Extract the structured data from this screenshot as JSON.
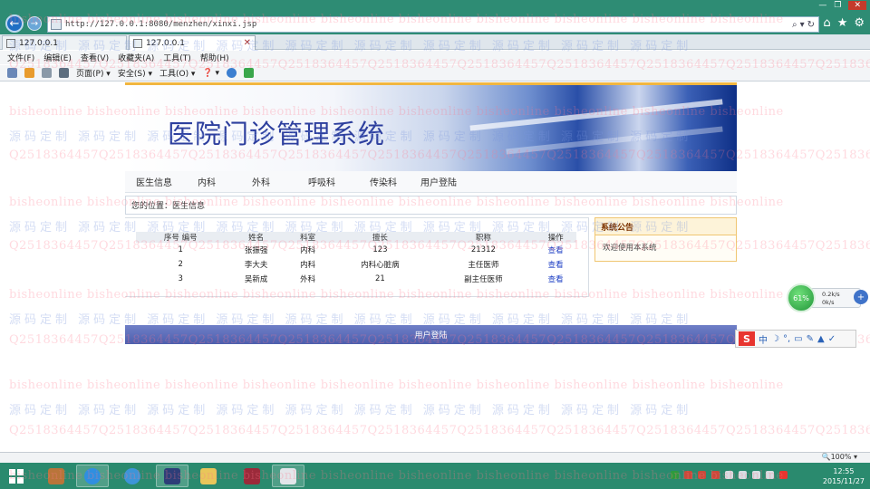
{
  "browser": {
    "url": "http://127.0.0.1:8080/menzhen/xinxi.jsp",
    "tabs": [
      {
        "label": "127.0.0.1"
      },
      {
        "label": "127.0.0.1",
        "active": true
      }
    ],
    "menu": [
      "文件(F)",
      "编辑(E)",
      "查看(V)",
      "收藏夹(A)",
      "工具(T)",
      "帮助(H)"
    ],
    "commands": {
      "page": "页面(P) ▾",
      "safety": "安全(S) ▾",
      "tools": "工具(O) ▾",
      "help": "❓ ▾"
    },
    "zoom": "🔍100%  ▾"
  },
  "site": {
    "title": "医院门诊管理系统",
    "nav": [
      "医生信息",
      "内科",
      "外科",
      "呼吸科",
      "传染科",
      "用户登陆"
    ],
    "breadcrumb": "您的位置：医生信息",
    "table": {
      "headers": [
        "编号",
        "姓名",
        "科室",
        "擅长",
        "职称",
        "操作"
      ],
      "leading_header": "序号",
      "rows": [
        {
          "id": "1",
          "name": "张振强",
          "dept": "内科",
          "specialty": "123",
          "title": "21312",
          "action": "查看"
        },
        {
          "id": "2",
          "name": "李大夫",
          "dept": "内科",
          "specialty": "内科心脏病",
          "title": "主任医师",
          "action": "查看"
        },
        {
          "id": "3",
          "name": "吴新成",
          "dept": "外科",
          "specialty": "21",
          "title": "副主任医师",
          "action": "查看"
        }
      ]
    },
    "notice": {
      "title": "系统公告",
      "body": "欢迎使用本系统"
    },
    "footer": "用户登陆"
  },
  "watermark": {
    "latin": "bisheonline",
    "cn": "源码定制",
    "qq": "Q2518364457"
  },
  "widgets": {
    "speed": {
      "percent": "61%",
      "up": "0.2k/s",
      "down": "0k/s"
    },
    "ime": "S"
  },
  "taskbar": {
    "time": "12:55",
    "date": "2015/11/27"
  },
  "colors": {
    "titlebar": "#2e8c74",
    "banner_text": "#2d3f9e",
    "footer": "#5a6ab8",
    "notice_border": "#f0c671"
  }
}
